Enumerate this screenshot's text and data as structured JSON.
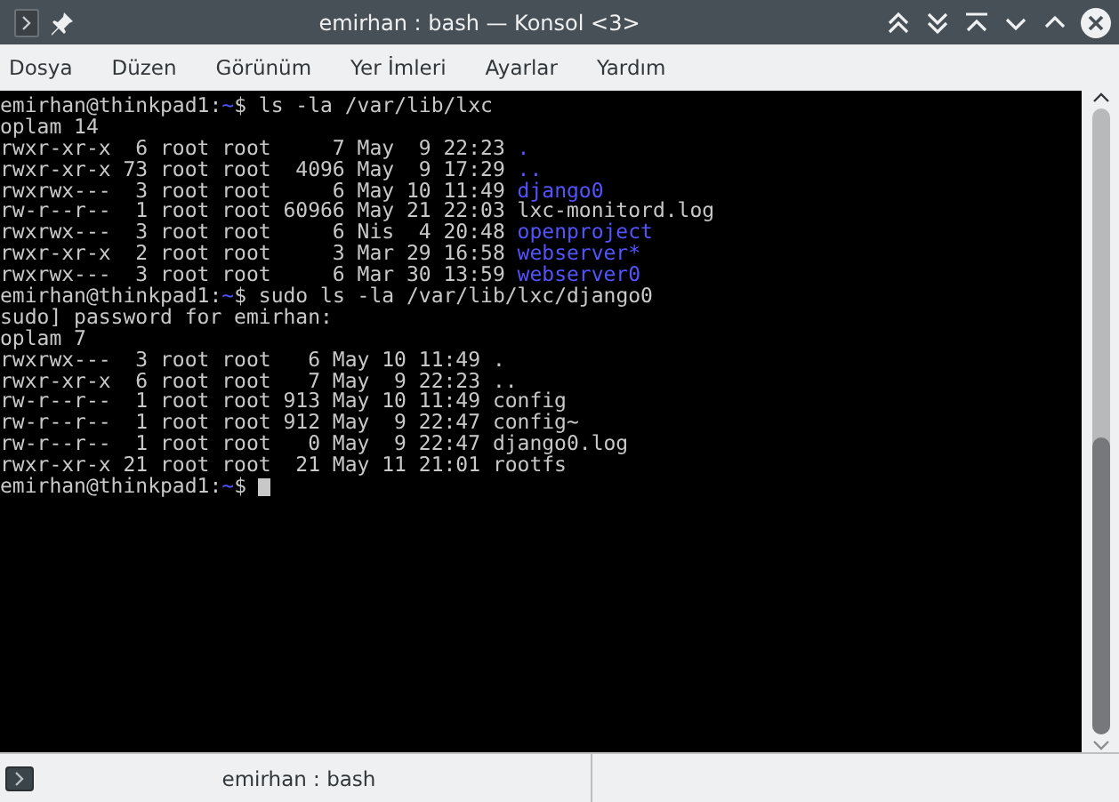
{
  "window": {
    "title": "emirhan : bash — Konsol <3>"
  },
  "menu": [
    {
      "label": "Dosya"
    },
    {
      "label": "Düzen"
    },
    {
      "label": "Görünüm"
    },
    {
      "label": "Yer İmleri"
    },
    {
      "label": "Ayarlar"
    },
    {
      "label": "Yardım"
    }
  ],
  "terminal": {
    "cursor": true,
    "lines": [
      [
        {
          "kind": "plain",
          "text": "emirhan@thinkpad1:"
        },
        {
          "kind": "path",
          "text": "~"
        },
        {
          "kind": "plain",
          "text": "$ ls -la /var/lib/lxc"
        }
      ],
      [
        {
          "kind": "plain",
          "text": "oplam 14"
        }
      ],
      [
        {
          "kind": "plain",
          "text": "rwxr-xr-x  6 root root     7 May  9 22:23 "
        },
        {
          "kind": "dir",
          "text": "."
        }
      ],
      [
        {
          "kind": "plain",
          "text": "rwxr-xr-x 73 root root  4096 May  9 17:29 "
        },
        {
          "kind": "dir",
          "text": ".."
        }
      ],
      [
        {
          "kind": "plain",
          "text": "rwxrwx---  3 root root     6 May 10 11:49 "
        },
        {
          "kind": "dir",
          "text": "django0"
        }
      ],
      [
        {
          "kind": "plain",
          "text": "rw-r--r--  1 root root 60966 May 21 22:03 lxc-monitord.log"
        }
      ],
      [
        {
          "kind": "plain",
          "text": "rwxrwx---  3 root root     6 Nis  4 20:48 "
        },
        {
          "kind": "dir",
          "text": "openproject"
        }
      ],
      [
        {
          "kind": "plain",
          "text": "rwxr-xr-x  2 root root     3 Mar 29 16:58 "
        },
        {
          "kind": "dir",
          "text": "webserver*"
        }
      ],
      [
        {
          "kind": "plain",
          "text": "rwxrwx---  3 root root     6 Mar 30 13:59 "
        },
        {
          "kind": "dir",
          "text": "webserver0"
        }
      ],
      [
        {
          "kind": "plain",
          "text": "emirhan@thinkpad1:"
        },
        {
          "kind": "path",
          "text": "~"
        },
        {
          "kind": "plain",
          "text": "$ sudo ls -la /var/lib/lxc/django0"
        }
      ],
      [
        {
          "kind": "plain",
          "text": "sudo] password for emirhan:"
        }
      ],
      [
        {
          "kind": "plain",
          "text": "oplam 7"
        }
      ],
      [
        {
          "kind": "plain",
          "text": "rwxrwx---  3 root root   6 May 10 11:49 ."
        }
      ],
      [
        {
          "kind": "plain",
          "text": "rwxr-xr-x  6 root root   7 May  9 22:23 .."
        }
      ],
      [
        {
          "kind": "plain",
          "text": "rw-r--r--  1 root root 913 May 10 11:49 config"
        }
      ],
      [
        {
          "kind": "plain",
          "text": "rw-r--r--  1 root root 912 May  9 22:47 config~"
        }
      ],
      [
        {
          "kind": "plain",
          "text": "rw-r--r--  1 root root   0 May  9 22:47 django0.log"
        }
      ],
      [
        {
          "kind": "plain",
          "text": "rwxr-xr-x 21 root root  21 May 11 21:01 rootfs"
        }
      ],
      [
        {
          "kind": "plain",
          "text": "emirhan@thinkpad1:"
        },
        {
          "kind": "path",
          "text": "~"
        },
        {
          "kind": "plain",
          "text": "$ "
        }
      ]
    ]
  },
  "tabs": [
    {
      "label": "emirhan : bash",
      "selected": true
    }
  ]
}
